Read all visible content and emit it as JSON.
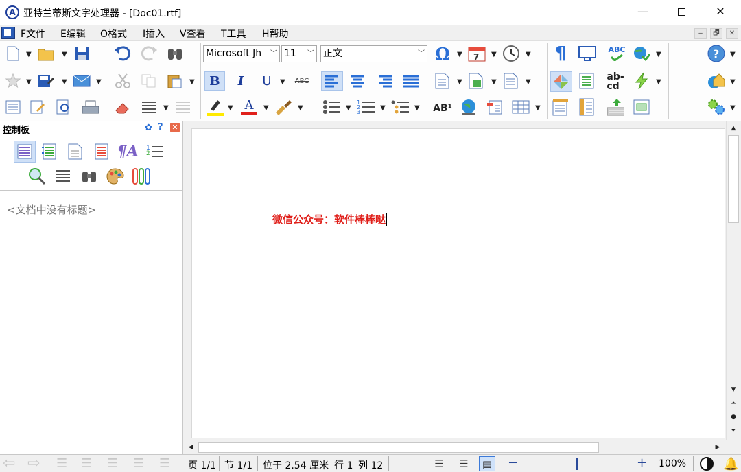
{
  "window": {
    "title": "亚特兰蒂斯文字处理器 - [Doc01.rtf]",
    "logo_letter": "A",
    "minimize": "—",
    "close": "✕"
  },
  "menu": {
    "items": [
      "F文件",
      "E编辑",
      "O格式",
      "I插入",
      "V查看",
      "T工具",
      "H帮助"
    ],
    "mdi": [
      "‒",
      "🗗",
      "✕"
    ]
  },
  "toolbar": {
    "font_name": "Microsoft Jh",
    "font_size": "11",
    "style": "正文",
    "bold": "B",
    "italic": "I",
    "underline": "U",
    "strike": "ABC",
    "font_color": "A",
    "pilcrow": "¶",
    "spell": "ABC",
    "abcd": "ab-\ncd",
    "ab_super": "AB¹",
    "calendar_day": "7"
  },
  "panel": {
    "title": "控制板",
    "no_headings": "<文档中没有标题>"
  },
  "document": {
    "text": "微信公众号：软件棒棒哒"
  },
  "statusbar": {
    "page": "页 1/1",
    "section": "节 1/1",
    "position": "位于 2.54 厘米",
    "line": "行 1",
    "column": "列 12",
    "zoom": "100%",
    "zoom_minus": "−",
    "zoom_plus": "+",
    "zoom_level": 1.0
  },
  "colors": {
    "doc_text": "#e0201b",
    "accent": "#2a5bb5",
    "highlight": "#ffea00",
    "font_color_bar": "#e0201b"
  }
}
